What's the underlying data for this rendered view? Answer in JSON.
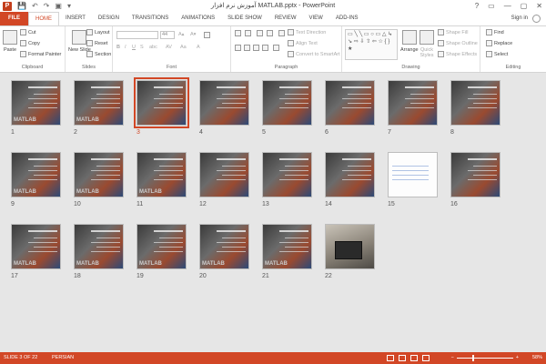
{
  "window": {
    "title": "آموزش نرم افزار MATLAB.pptx - PowerPoint",
    "app_icon": "P",
    "buttons": [
      "?",
      "▭",
      "—",
      "▢",
      "✕"
    ]
  },
  "quick_access": [
    "save-icon",
    "undo-icon",
    "redo-icon",
    "start-from-beginning-icon"
  ],
  "tabs": [
    {
      "label": "FILE"
    },
    {
      "label": "HOME"
    },
    {
      "label": "INSERT"
    },
    {
      "label": "DESIGN"
    },
    {
      "label": "TRANSITIONS"
    },
    {
      "label": "ANIMATIONS"
    },
    {
      "label": "SLIDE SHOW"
    },
    {
      "label": "REVIEW"
    },
    {
      "label": "VIEW"
    },
    {
      "label": "ADD-INS"
    }
  ],
  "active_tab": "HOME",
  "sign_in": "Sign in",
  "ribbon": {
    "clipboard": {
      "paste": "Paste",
      "cut": "Cut",
      "copy": "Copy",
      "format_painter": "Format Painter",
      "label": "Clipboard"
    },
    "slides": {
      "new_slide": "New Slide",
      "layout": "Layout",
      "reset": "Reset",
      "section": "Section",
      "label": "Slides"
    },
    "font": {
      "font_name": "",
      "font_size": "44",
      "label": "Font"
    },
    "paragraph": {
      "text_direction": "Text Direction",
      "align_text": "Align Text",
      "convert_smartart": "Convert to SmartArt",
      "label": "Paragraph"
    },
    "drawing": {
      "shapes_preview": "▭ ╲ ╲ ▭ ○ ▭ △ ↳ ↘ ⇨ ⇩ ⇧ ⇦ ☆ { } ★",
      "arrange": "Arrange",
      "quick_styles": "Quick Styles",
      "shape_fill": "Shape Fill",
      "shape_outline": "Shape Outline",
      "shape_effects": "Shape Effects",
      "label": "Drawing"
    },
    "editing": {
      "find": "Find",
      "replace": "Replace",
      "select": "Select",
      "label": "Editing"
    }
  },
  "slides": [
    {
      "num": "1",
      "kind": "dark",
      "logo": "MATLAB"
    },
    {
      "num": "2",
      "kind": "dark",
      "logo": "MATLAB"
    },
    {
      "num": "3",
      "kind": "dark",
      "logo": "",
      "selected": true
    },
    {
      "num": "4",
      "kind": "dark",
      "logo": ""
    },
    {
      "num": "5",
      "kind": "dark",
      "logo": ""
    },
    {
      "num": "6",
      "kind": "dark",
      "logo": ""
    },
    {
      "num": "7",
      "kind": "dark",
      "logo": ""
    },
    {
      "num": "8",
      "kind": "dark",
      "logo": ""
    },
    {
      "num": "9",
      "kind": "dark",
      "logo": "MATLAB"
    },
    {
      "num": "10",
      "kind": "dark",
      "logo": "MATLAB"
    },
    {
      "num": "11",
      "kind": "dark",
      "logo": "MATLAB"
    },
    {
      "num": "12",
      "kind": "dark",
      "logo": ""
    },
    {
      "num": "13",
      "kind": "dark",
      "logo": ""
    },
    {
      "num": "14",
      "kind": "dark",
      "logo": ""
    },
    {
      "num": "15",
      "kind": "white",
      "logo": ""
    },
    {
      "num": "16",
      "kind": "dark",
      "logo": ""
    },
    {
      "num": "17",
      "kind": "dark",
      "logo": "MATLAB"
    },
    {
      "num": "18",
      "kind": "dark",
      "logo": "MATLAB"
    },
    {
      "num": "19",
      "kind": "dark",
      "logo": "MATLAB"
    },
    {
      "num": "20",
      "kind": "dark",
      "logo": "MATLAB"
    },
    {
      "num": "21",
      "kind": "dark",
      "logo": "MATLAB"
    },
    {
      "num": "22",
      "kind": "photo",
      "logo": ""
    }
  ],
  "status": {
    "slide_info": "SLIDE 3 OF 22",
    "language": "PERSIAN",
    "zoom_minus": "−",
    "zoom_plus": "+",
    "zoom_percent": "58%",
    "zoom_level": 0.58
  },
  "colors": {
    "accent": "#d24726",
    "status_bar": "#d24726",
    "selected_outline": "#d24726"
  }
}
